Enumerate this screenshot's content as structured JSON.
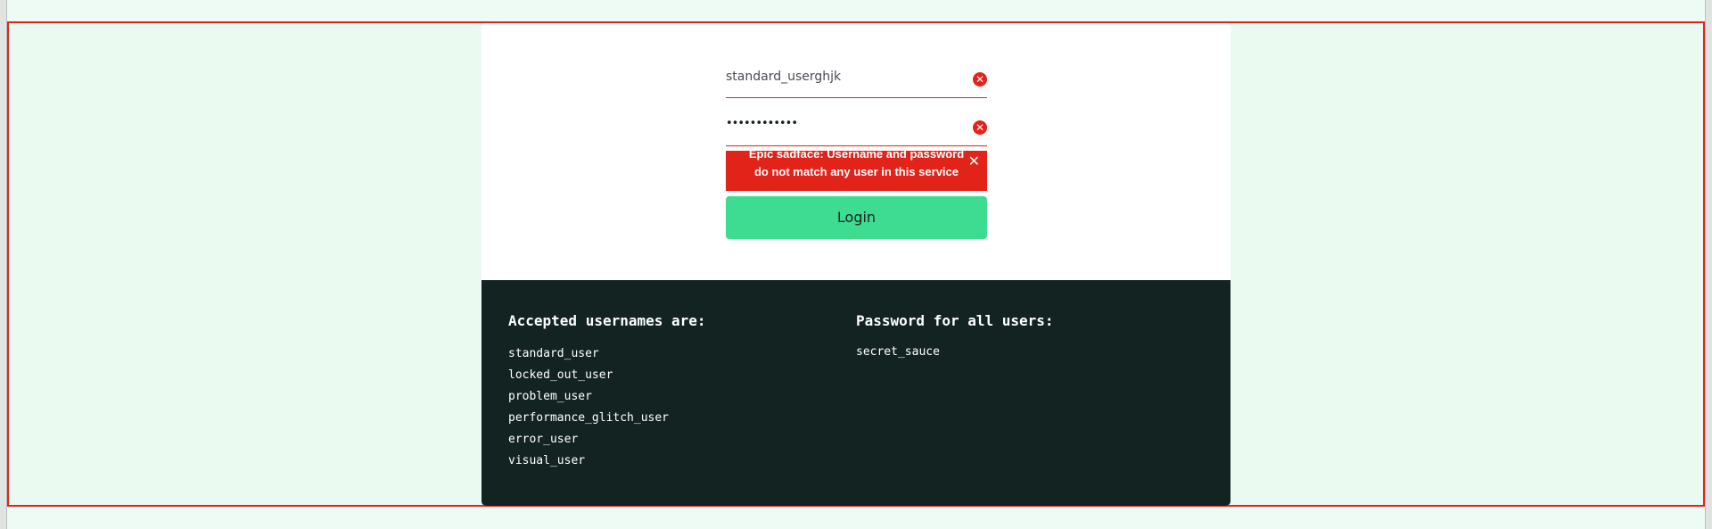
{
  "login_form": {
    "username_value": "standard_userghjk",
    "password_value": "••••••••••••",
    "error_message": "Epic sadface: Username and password do not match any user in this service",
    "login_label": "Login",
    "error_icon_glyph": "✕",
    "close_glyph": "✕"
  },
  "credentials": {
    "usernames_heading": "Accepted usernames are:",
    "usernames": [
      "standard_user",
      "locked_out_user",
      "problem_user",
      "performance_glitch_user",
      "error_user",
      "visual_user"
    ],
    "password_heading": "Password for all users:",
    "password": "secret_sauce"
  },
  "colors": {
    "error": "#e2231a",
    "accent": "#3ddc91",
    "dark_panel": "#132322",
    "background": "#eefaf4"
  },
  "icons": [
    "error-circle-icon",
    "close-icon"
  ]
}
